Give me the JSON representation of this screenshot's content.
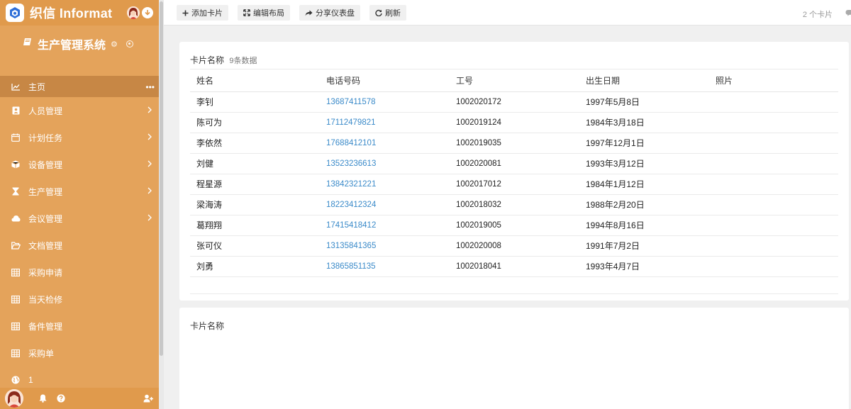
{
  "brand": {
    "name": "织信 Informat"
  },
  "system": {
    "title": "生产管理系统"
  },
  "menu": {
    "items": [
      {
        "label": "主页",
        "icon": "chart-line-icon",
        "active": true
      },
      {
        "label": "人员管理",
        "icon": "user-badge-icon",
        "submenu": true
      },
      {
        "label": "计划任务",
        "icon": "calendar-icon",
        "submenu": true
      },
      {
        "label": "设备管理",
        "icon": "cube-icon",
        "submenu": true
      },
      {
        "label": "生产管理",
        "icon": "hourglass-icon",
        "submenu": true
      },
      {
        "label": "会议管理",
        "icon": "cloud-icon",
        "submenu": true
      },
      {
        "label": "文档管理",
        "icon": "folder-open-icon"
      },
      {
        "label": "采购申请",
        "icon": "table-icon"
      },
      {
        "label": "当天检修",
        "icon": "table-icon"
      },
      {
        "label": "备件管理",
        "icon": "table-icon"
      },
      {
        "label": "采购单",
        "icon": "table-icon"
      },
      {
        "label": "1",
        "icon": "globe-icon"
      }
    ]
  },
  "toolbar": {
    "add_card": "添加卡片",
    "edit_layout": "编辑布局",
    "share_dashboard": "分享仪表盘",
    "refresh": "刷新",
    "card_count": "2 个卡片"
  },
  "card1": {
    "title": "卡片名称",
    "count": "9条数据",
    "columns": [
      "姓名",
      "电话号码",
      "工号",
      "出生日期",
      "照片"
    ],
    "rows": [
      [
        "李钊",
        "13687411578",
        "1002020172",
        "1997年5月8日",
        ""
      ],
      [
        "陈可为",
        "17112479821",
        "1002019124",
        "1984年3月18日",
        ""
      ],
      [
        "李依然",
        "17688412101",
        "1002019035",
        "1997年12月1日",
        ""
      ],
      [
        "刘健",
        "13523236613",
        "1002020081",
        "1993年3月12日",
        ""
      ],
      [
        "程星源",
        "13842321221",
        "1002017012",
        "1984年1月12日",
        ""
      ],
      [
        "梁海涛",
        "18223412324",
        "1002018032",
        "1988年2月20日",
        ""
      ],
      [
        "葛翔翔",
        "17415418412",
        "1002019005",
        "1994年8月16日",
        ""
      ],
      [
        "张可仪",
        "13135841365",
        "1002020008",
        "1991年7月2日",
        ""
      ],
      [
        "刘勇",
        "13865851135",
        "1002018041",
        "1993年4月7日",
        ""
      ]
    ]
  },
  "card2": {
    "title": "卡片名称"
  },
  "colors": {
    "sidebar": "#e4a35b",
    "sidebar_active": "#c78745",
    "link": "#3a8ac9"
  }
}
